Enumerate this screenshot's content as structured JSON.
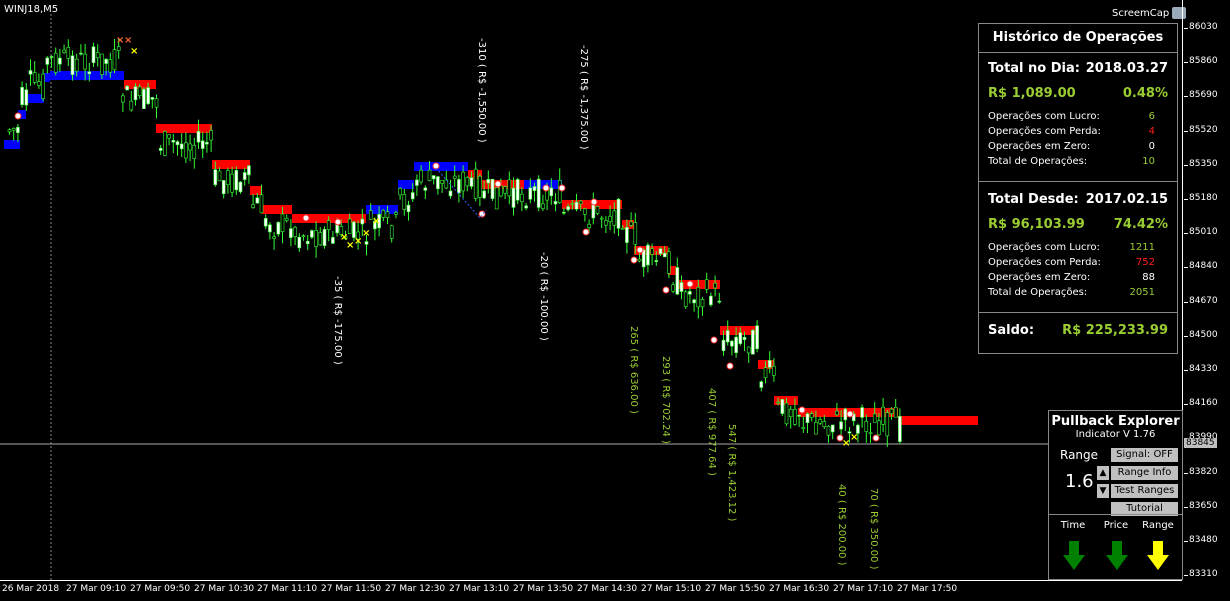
{
  "symbol": "WINJ18,M5",
  "screencap": "ScreemCap",
  "price_axis": [
    "86030",
    "85860",
    "85690",
    "85520",
    "85350",
    "85180",
    "85010",
    "84840",
    "84670",
    "84500",
    "84330",
    "84160",
    "83990",
    "83820",
    "83650",
    "83480",
    "83310"
  ],
  "current_price": "83845",
  "time_axis": [
    "26 Mar 2018",
    "27 Mar 09:10",
    "27 Mar 09:50",
    "27 Mar 10:30",
    "27 Mar 11:10",
    "27 Mar 11:50",
    "27 Mar 12:30",
    "27 Mar 13:10",
    "27 Mar 13:50",
    "27 Mar 14:30",
    "27 Mar 15:10",
    "27 Mar 15:50",
    "27 Mar 16:30",
    "27 Mar 17:10",
    "27 Mar 17:50"
  ],
  "annotations": [
    {
      "text": "-310 ( R$ -1,550.00 )",
      "color": "#ffffff"
    },
    {
      "text": "-275 ( R$ -1,375.00 )",
      "color": "#ffffff"
    },
    {
      "text": "-35 ( R$ -175.00 )",
      "color": "#ffffff"
    },
    {
      "text": "-20 ( R$ -100.00 )",
      "color": "#ffffff"
    },
    {
      "text": "265 ( R$ 636.00 )",
      "color": "#9acd32"
    },
    {
      "text": "293 ( R$ 702.24 )",
      "color": "#9acd32"
    },
    {
      "text": "407 ( R$ 977.64 )",
      "color": "#9acd32"
    },
    {
      "text": "547 ( R$ 1,423.12 )",
      "color": "#9acd32"
    },
    {
      "text": "40 ( R$ 200.00 )",
      "color": "#9acd32"
    },
    {
      "text": "70 ( R$ 350.00 )",
      "color": "#9acd32"
    }
  ],
  "history": {
    "title": "Histórico de Operações",
    "day_label": "Total no Dia:",
    "day_date": "2018.03.27",
    "day_money": "R$ 1,089.00",
    "day_pct": "0.48%",
    "day_rows": [
      {
        "label": "Operações com Lucro:",
        "value": "6",
        "color": "#9acd32"
      },
      {
        "label": "Operações com Perda:",
        "value": "4",
        "color": "#ff2020"
      },
      {
        "label": "Operações em Zero:",
        "value": "0",
        "color": "#ffffff"
      },
      {
        "label": "Total de Operações:",
        "value": "10",
        "color": "#9acd32"
      }
    ],
    "since_label": "Total Desde:",
    "since_date": "2017.02.15",
    "since_money": "R$ 96,103.99",
    "since_pct": "74.42%",
    "since_rows": [
      {
        "label": "Operações com Lucro:",
        "value": "1211",
        "color": "#9acd32"
      },
      {
        "label": "Operações com Perda:",
        "value": "752",
        "color": "#ff2020"
      },
      {
        "label": "Operações em Zero:",
        "value": "88",
        "color": "#ffffff"
      },
      {
        "label": "Total de Operações:",
        "value": "2051",
        "color": "#9acd32"
      }
    ],
    "saldo_label": "Saldo:",
    "saldo_value": "R$ 225,233.99"
  },
  "pullback": {
    "title": "Pullback Explorer",
    "subtitle": "Indicator V 1.76",
    "range_label": "Range",
    "range_value": "1.6",
    "buttons": [
      "Signal: OFF",
      "Range Info",
      "Test Ranges",
      "Tutorial"
    ],
    "columns": [
      "Time",
      "Price",
      "Range"
    ],
    "arrow_colors": [
      "#008000",
      "#008000",
      "#ffff00"
    ]
  }
}
